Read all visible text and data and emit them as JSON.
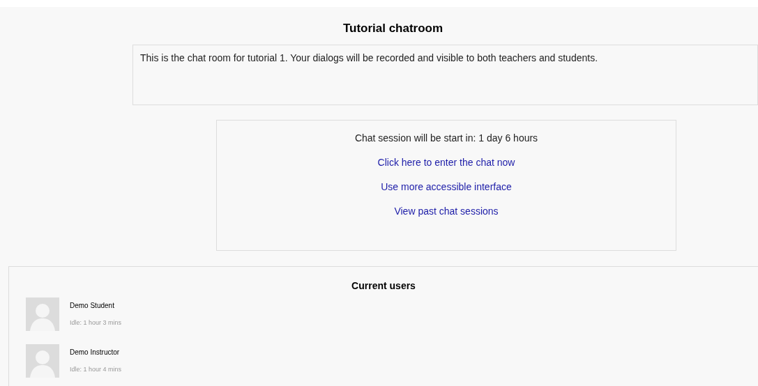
{
  "title": "Tutorial chatroom",
  "description": "This is the chat room for tutorial 1. Your dialogs will be recorded and visible to both teachers and students.",
  "session": {
    "status": "Chat session will be start in: 1 day 6 hours",
    "links": [
      "Click here to enter the chat now",
      "Use more accessible interface",
      "View past chat sessions"
    ]
  },
  "current_users": {
    "heading": "Current users",
    "users": [
      {
        "name": "Demo Student",
        "idle": "Idle: 1 hour 3 mins"
      },
      {
        "name": "Demo Instructor",
        "idle": "Idle: 1 hour 4 mins"
      }
    ]
  }
}
